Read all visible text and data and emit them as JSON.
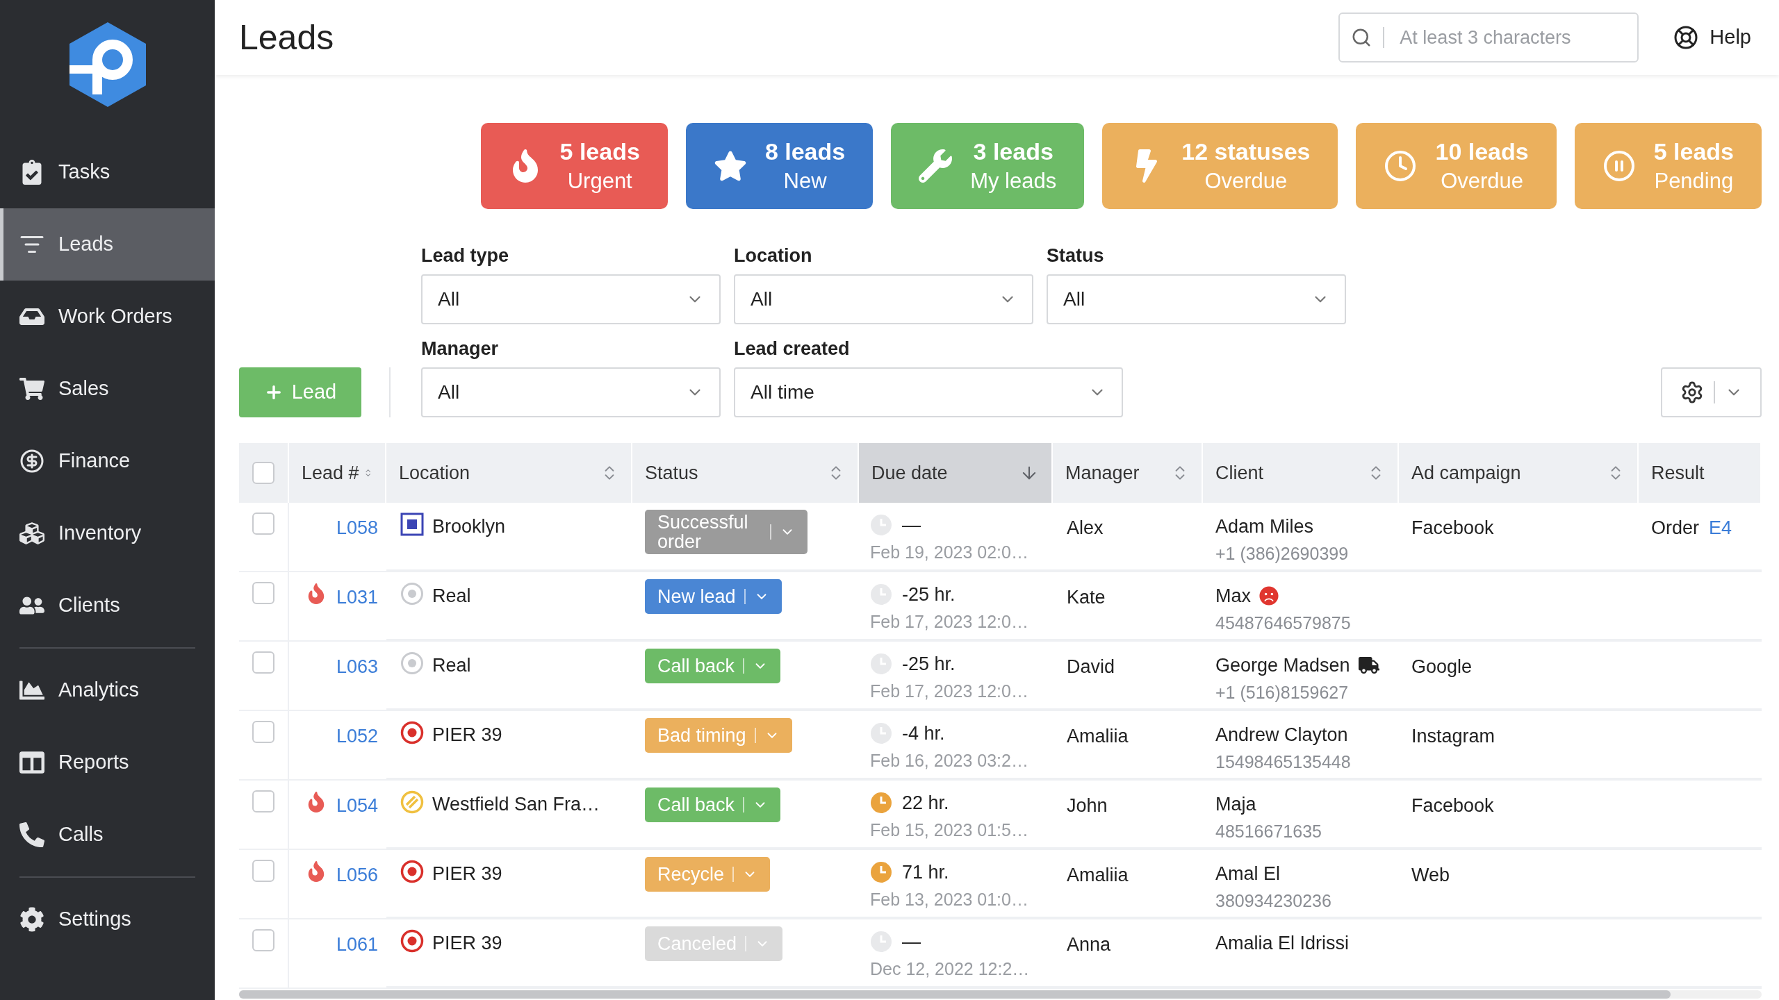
{
  "sidebar": {
    "groups": [
      [
        {
          "label": "Tasks",
          "selected": false
        },
        {
          "label": "Leads",
          "selected": true
        },
        {
          "label": "Work Orders",
          "selected": false
        },
        {
          "label": "Sales",
          "selected": false
        },
        {
          "label": "Finance",
          "selected": false
        },
        {
          "label": "Inventory",
          "selected": false
        },
        {
          "label": "Clients",
          "selected": false
        }
      ],
      [
        {
          "label": "Analytics",
          "selected": false
        },
        {
          "label": "Reports",
          "selected": false
        },
        {
          "label": "Calls",
          "selected": false
        }
      ],
      [
        {
          "label": "Settings",
          "selected": false
        }
      ]
    ]
  },
  "header": {
    "title": "Leads",
    "search": {
      "placeholder": "At least 3 characters"
    },
    "help": "Help"
  },
  "summary_cards": [
    {
      "count": "5 leads",
      "label": "Urgent",
      "color": "#e85b55"
    },
    {
      "count": "8 leads",
      "label": "New",
      "color": "#3b78c9"
    },
    {
      "count": "3 leads",
      "label": "My leads",
      "color": "#6dbb67"
    },
    {
      "count": "12 statuses",
      "label": "Overdue",
      "color": "#ebb05d"
    },
    {
      "count": "10 leads",
      "label": "Overdue",
      "color": "#ebb05d"
    },
    {
      "count": "5 leads",
      "label": "Pending",
      "color": "#ebb05d"
    }
  ],
  "filter_rows": [
    [
      {
        "label": "Lead type",
        "value": "All"
      },
      {
        "label": "Location",
        "value": "All"
      },
      {
        "label": "Status",
        "value": "All"
      }
    ],
    [
      {
        "label": "Manager",
        "value": "All"
      },
      {
        "label": "Lead created",
        "value": "All time"
      }
    ]
  ],
  "add_button": "Lead",
  "table": {
    "select_all": {
      "checked": false
    },
    "columns": [
      {
        "label": "Lead #",
        "sortable": true,
        "sorted": false
      },
      {
        "label": "Location",
        "sortable": true,
        "sorted": false
      },
      {
        "label": "Status",
        "sortable": true,
        "sorted": false
      },
      {
        "label": "Due date",
        "sortable": true,
        "sorted": true
      },
      {
        "label": "Manager",
        "sortable": true,
        "sorted": false
      },
      {
        "label": "Client",
        "sortable": true,
        "sorted": false
      },
      {
        "label": "Ad campaign",
        "sortable": true,
        "sorted": false
      },
      {
        "label": "Result",
        "sortable": false,
        "sorted": false
      }
    ],
    "rows": [
      {
        "checked": false,
        "urgent": false,
        "lead": "L058",
        "location": {
          "name": "Brooklyn",
          "kind": "square"
        },
        "status": {
          "label": "Successful order",
          "color": "#9b9b9b"
        },
        "due": {
          "value": "—",
          "date": "Feb 19, 2023 02:0…",
          "soon": false
        },
        "manager": "Alex",
        "client": {
          "name": "Adam Miles",
          "phone": "+1 (386)2690399",
          "unhappy": false,
          "truck": false
        },
        "ad_campaign": "Facebook",
        "result": {
          "text": "Order",
          "link": "E4"
        }
      },
      {
        "checked": false,
        "urgent": true,
        "lead": "L031",
        "location": {
          "name": "Real",
          "kind": "ring"
        },
        "status": {
          "label": "New lead",
          "color": "#4a86d4"
        },
        "due": {
          "value": "-25 hr.",
          "date": "Feb 17, 2023 12:0…",
          "soon": false
        },
        "manager": "Kate",
        "client": {
          "name": "Max",
          "phone": "45487646579875",
          "unhappy": true,
          "truck": false
        }
      },
      {
        "checked": false,
        "urgent": false,
        "lead": "L063",
        "location": {
          "name": "Real",
          "kind": "ring"
        },
        "status": {
          "label": "Call back",
          "color": "#6dbb67"
        },
        "due": {
          "value": "-25 hr.",
          "date": "Feb 17, 2023 12:0…",
          "soon": false
        },
        "manager": "David",
        "client": {
          "name": "George Madsen",
          "phone": "+1 (516)8159627",
          "unhappy": false,
          "truck": true
        },
        "ad_campaign": "Google"
      },
      {
        "checked": false,
        "urgent": false,
        "lead": "L052",
        "location": {
          "name": "PIER 39",
          "kind": "target"
        },
        "status": {
          "label": "Bad timing",
          "color": "#ebb05d"
        },
        "due": {
          "value": "-4 hr.",
          "date": "Feb 16, 2023 03:2…",
          "soon": false
        },
        "manager": "Amaliia",
        "client": {
          "name": "Andrew Clayton",
          "phone": "15498465135448",
          "unhappy": false,
          "truck": false
        },
        "ad_campaign": "Instagram"
      },
      {
        "checked": false,
        "urgent": true,
        "lead": "L054",
        "location": {
          "name": "Westfield San Fra…",
          "kind": "striped"
        },
        "status": {
          "label": "Call back",
          "color": "#6dbb67"
        },
        "due": {
          "value": "22 hr.",
          "date": "Feb 15, 2023 01:5…",
          "soon": true
        },
        "manager": "John",
        "client": {
          "name": "Maja",
          "phone": "48516671635",
          "unhappy": false,
          "truck": false
        },
        "ad_campaign": "Facebook"
      },
      {
        "checked": false,
        "urgent": true,
        "lead": "L056",
        "location": {
          "name": "PIER 39",
          "kind": "target"
        },
        "status": {
          "label": "Recycle",
          "color": "#ebb05d"
        },
        "due": {
          "value": "71 hr.",
          "date": "Feb 13, 2023 01:0…",
          "soon": true
        },
        "manager": "Amaliia",
        "client": {
          "name": "Amal El",
          "phone": "380934230236",
          "unhappy": false,
          "truck": false
        },
        "ad_campaign": "Web"
      },
      {
        "checked": false,
        "urgent": false,
        "lead": "L061",
        "location": {
          "name": "PIER 39",
          "kind": "target"
        },
        "status": {
          "label": "Canceled",
          "color": "#dadada"
        },
        "due": {
          "value": "—",
          "date": "Dec 12, 2022 12:2…",
          "soon": false
        },
        "manager": "Anna",
        "client": {
          "name": "Amalia El Idrissi",
          "unhappy": false,
          "truck": false
        }
      }
    ]
  }
}
